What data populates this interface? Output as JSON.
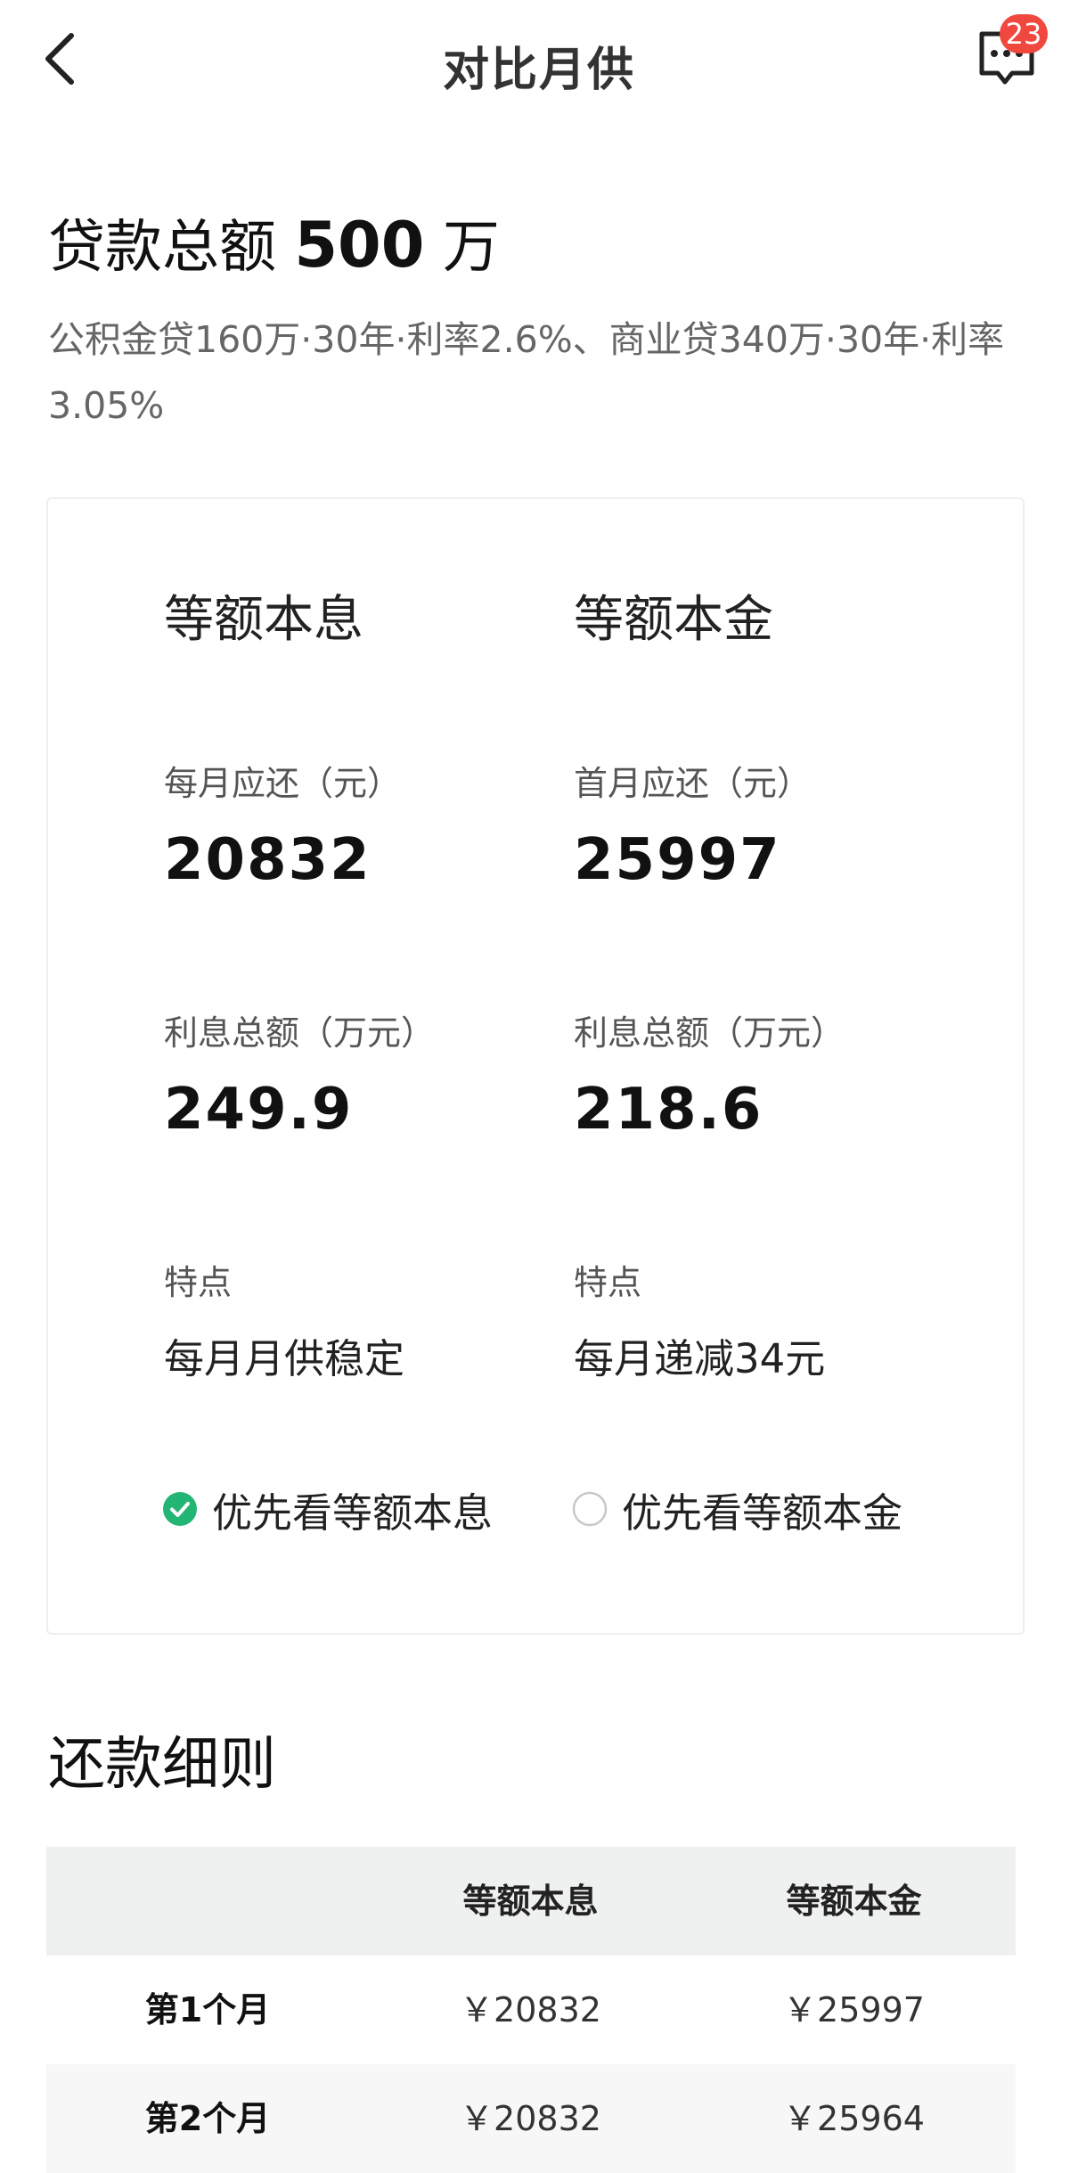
{
  "header": {
    "title": "对比月供",
    "badge_count": "23",
    "icons": {
      "back": "chevron-left-icon",
      "messages": "chat-bubble-icon"
    }
  },
  "loan": {
    "total_prefix": "贷款总额",
    "total_amount": "500",
    "total_unit": "万",
    "description": "公积金贷160万·30年·利率2.6%、商业贷340万·30年·利率3.05%"
  },
  "comparison": {
    "equal_installment": {
      "name": "等额本息",
      "monthly_label": "每月应还（元）",
      "monthly_value": "20832",
      "interest_label": "利息总额（万元）",
      "interest_value": "249.9",
      "feature_label": "特点",
      "feature_value": "每月月供稳定",
      "option_label": "优先看等额本息",
      "selected": true
    },
    "equal_principal": {
      "name": "等额本金",
      "monthly_label": "首月应还（元）",
      "monthly_value": "25997",
      "interest_label": "利息总额（万元）",
      "interest_value": "218.6",
      "feature_label": "特点",
      "feature_value": "每月递减34元",
      "option_label": "优先看等额本金",
      "selected": false
    }
  },
  "details": {
    "title": "还款细则",
    "columns": [
      "",
      "等额本息",
      "等额本金"
    ],
    "rows": [
      {
        "period": "第1个月",
        "equal_installment": "￥20832",
        "equal_principal": "￥25997"
      },
      {
        "period": "第2个月",
        "equal_installment": "￥20832",
        "equal_principal": "￥25964"
      }
    ]
  },
  "colors": {
    "accent_green": "#22b573",
    "badge_red": "#f0483e",
    "table_header_bg": "#eff0f0"
  }
}
